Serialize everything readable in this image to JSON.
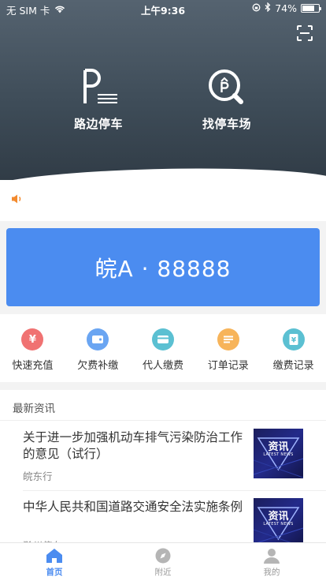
{
  "status_bar": {
    "carrier": "无 SIM 卡",
    "time": "上午9:36",
    "battery": "74%",
    "battery_level": 0.74
  },
  "features": [
    {
      "label": "路边停车"
    },
    {
      "label": "找停车场"
    }
  ],
  "plate": {
    "text": "皖A · 88888"
  },
  "quick_actions": [
    {
      "label": "快速充值",
      "icon": "yuan-icon",
      "color": "#f07272"
    },
    {
      "label": "欠费补缴",
      "icon": "wallet-icon",
      "color": "#6aa5f2"
    },
    {
      "label": "代人缴费",
      "icon": "card-icon",
      "color": "#5bc0d2"
    },
    {
      "label": "订单记录",
      "icon": "list-icon",
      "color": "#f7b45a"
    },
    {
      "label": "缴费记录",
      "icon": "receipt-icon",
      "color": "#5bc0d2"
    }
  ],
  "news": {
    "title": "最新资讯",
    "thumb_text": "资讯",
    "thumb_sub": "LATEST NEWS",
    "items": [
      {
        "headline": "关于进一步加强机动车排气污染防治工作的意见（试行）",
        "source": "皖东行"
      },
      {
        "headline": "中华人民共和国道路交通安全法实施条例",
        "source": "滁州停车"
      }
    ]
  },
  "tabs": [
    {
      "label": "首页",
      "icon": "home-icon",
      "active": true
    },
    {
      "label": "附近",
      "icon": "compass-icon",
      "active": false
    },
    {
      "label": "我的",
      "icon": "user-icon",
      "active": false
    }
  ],
  "colors": {
    "accent": "#4b8cf0",
    "header": "#3e4c58",
    "inactive_tab": "#999999"
  }
}
